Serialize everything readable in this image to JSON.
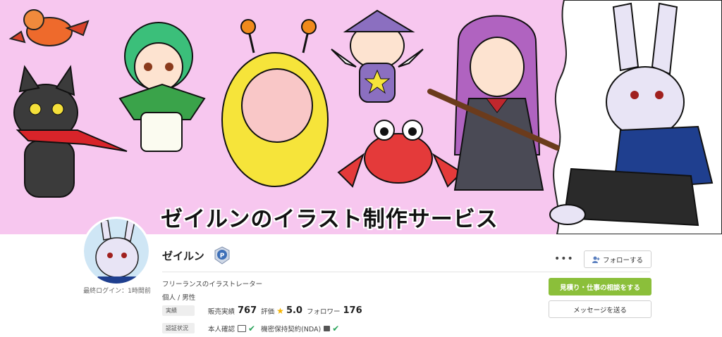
{
  "banner": {
    "title": "ゼイルンのイラスト制作サービス"
  },
  "profile": {
    "name": "ゼイルン",
    "last_login": "最終ログイン：1時間前",
    "tagline": "フリーランスのイラストレーター",
    "kind": "個人 / 男性"
  },
  "stats": {
    "tag_label": "実績",
    "sales_label": "販売実績",
    "sales_value": "767",
    "rating_label": "評価",
    "rating_value": "5.0",
    "followers_label": "フォロワー",
    "followers_value": "176"
  },
  "verification": {
    "tag_label": "認証状況",
    "identity_label": "本人確認",
    "nda_label": "機密保持契約(NDA)"
  },
  "actions": {
    "more_label": "•••",
    "follow_label": "フォローする",
    "quote_label": "見積り・仕事の相談をする",
    "message_label": "メッセージを送る"
  },
  "colors": {
    "banner_bg": "#f7c7ef",
    "primary_green": "#8bbf3a",
    "check_green": "#2aa45b",
    "star": "#f5b301"
  }
}
